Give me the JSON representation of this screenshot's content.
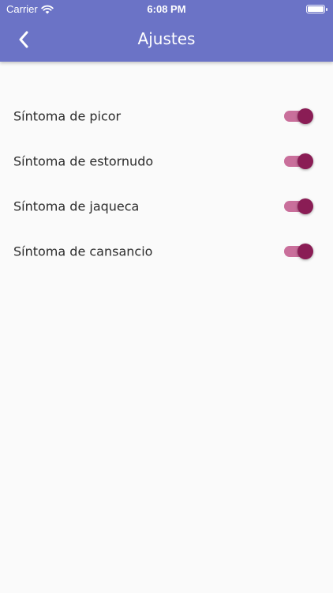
{
  "status_bar": {
    "carrier": "Carrier",
    "time": "6:08 PM",
    "wifi_icon": "wifi-icon",
    "battery_icon": "battery-icon",
    "battery_level": 1.0
  },
  "app_bar": {
    "title": "Ajustes",
    "back_icon": "chevron-left-icon",
    "background_color": "#6b73c6"
  },
  "settings": {
    "items": [
      {
        "label": "Síntoma de picor",
        "enabled": true
      },
      {
        "label": "Síntoma de estornudo",
        "enabled": true
      },
      {
        "label": "Síntoma de jaqueca",
        "enabled": true
      },
      {
        "label": "Síntoma de cansancio",
        "enabled": true
      }
    ],
    "toggle_active_color": "#8a1d55",
    "toggle_track_color": "#c96f9b"
  }
}
